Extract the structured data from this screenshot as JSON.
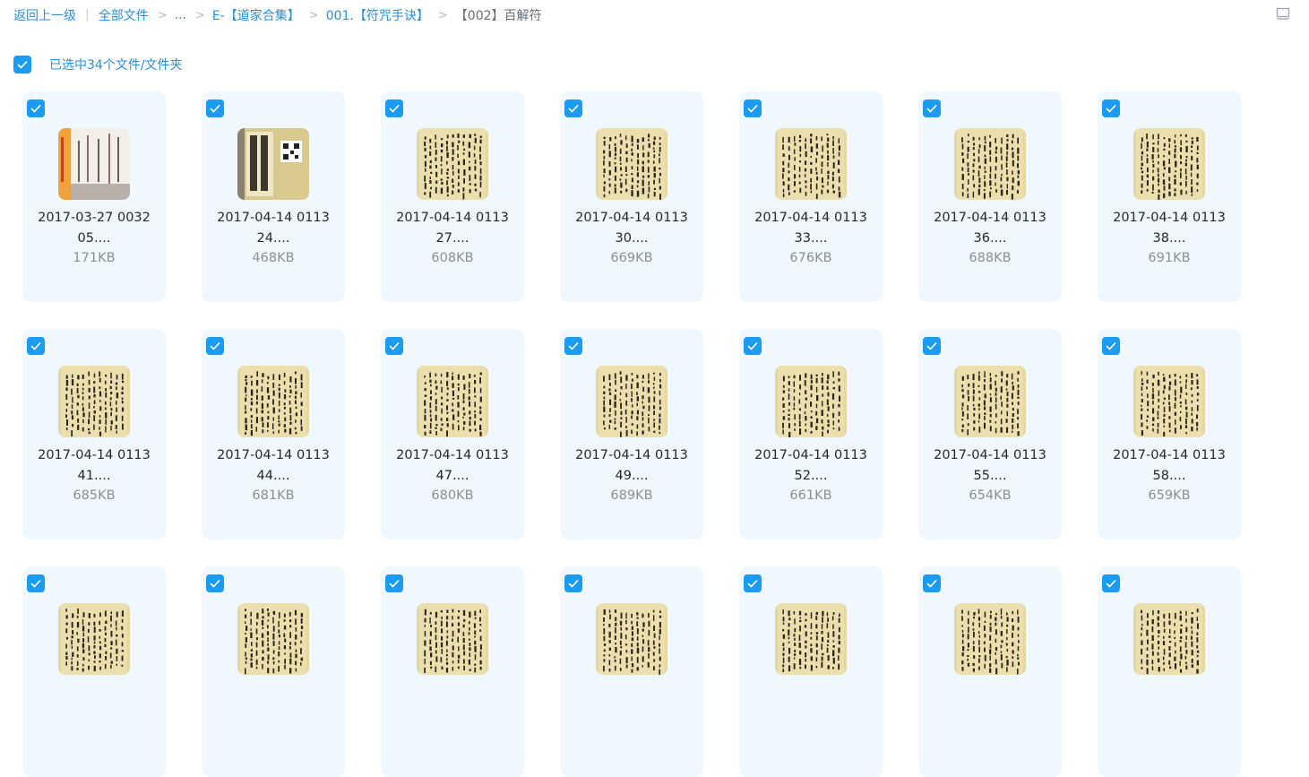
{
  "breadcrumb": {
    "back": "返回上一级",
    "root": "全部文件",
    "ellipsis": "...",
    "level1": "E-【道家合集】",
    "level2": "001.【符咒手诀】",
    "current": "【002】百解符",
    "separator": ">"
  },
  "selection": {
    "label": "已选中34个文件/文件夹",
    "checked": true
  },
  "icons": {
    "checkbox": "check-icon",
    "view_toggle": "list-view-icon"
  },
  "colors": {
    "accent": "#1b9cf2",
    "link": "#2a8fd8",
    "card_bg": "#eef8fe"
  },
  "files": [
    {
      "name_line1": "2017-03-27 0032",
      "name_line2": "05....",
      "size": "171KB",
      "thumb": "cover-orange"
    },
    {
      "name_line1": "2017-04-14 0113",
      "name_line2": "24....",
      "size": "468KB",
      "thumb": "cover-title"
    },
    {
      "name_line1": "2017-04-14 0113",
      "name_line2": "27....",
      "size": "608KB",
      "thumb": "scan"
    },
    {
      "name_line1": "2017-04-14 0113",
      "name_line2": "30....",
      "size": "669KB",
      "thumb": "scan"
    },
    {
      "name_line1": "2017-04-14 0113",
      "name_line2": "33....",
      "size": "676KB",
      "thumb": "scan"
    },
    {
      "name_line1": "2017-04-14 0113",
      "name_line2": "36....",
      "size": "688KB",
      "thumb": "scan"
    },
    {
      "name_line1": "2017-04-14 0113",
      "name_line2": "38....",
      "size": "691KB",
      "thumb": "scan"
    },
    {
      "name_line1": "2017-04-14 0113",
      "name_line2": "41....",
      "size": "685KB",
      "thumb": "scan"
    },
    {
      "name_line1": "2017-04-14 0113",
      "name_line2": "44....",
      "size": "681KB",
      "thumb": "scan"
    },
    {
      "name_line1": "2017-04-14 0113",
      "name_line2": "47....",
      "size": "680KB",
      "thumb": "scan"
    },
    {
      "name_line1": "2017-04-14 0113",
      "name_line2": "49....",
      "size": "689KB",
      "thumb": "scan"
    },
    {
      "name_line1": "2017-04-14 0113",
      "name_line2": "52....",
      "size": "661KB",
      "thumb": "scan"
    },
    {
      "name_line1": "2017-04-14 0113",
      "name_line2": "55....",
      "size": "654KB",
      "thumb": "scan"
    },
    {
      "name_line1": "2017-04-14 0113",
      "name_line2": "58....",
      "size": "659KB",
      "thumb": "scan"
    },
    {
      "name_line1": "",
      "name_line2": "",
      "size": "",
      "thumb": "scan"
    },
    {
      "name_line1": "",
      "name_line2": "",
      "size": "",
      "thumb": "scan"
    },
    {
      "name_line1": "",
      "name_line2": "",
      "size": "",
      "thumb": "scan"
    },
    {
      "name_line1": "",
      "name_line2": "",
      "size": "",
      "thumb": "scan"
    },
    {
      "name_line1": "",
      "name_line2": "",
      "size": "",
      "thumb": "scan"
    },
    {
      "name_line1": "",
      "name_line2": "",
      "size": "",
      "thumb": "scan"
    },
    {
      "name_line1": "",
      "name_line2": "",
      "size": "",
      "thumb": "scan"
    }
  ]
}
